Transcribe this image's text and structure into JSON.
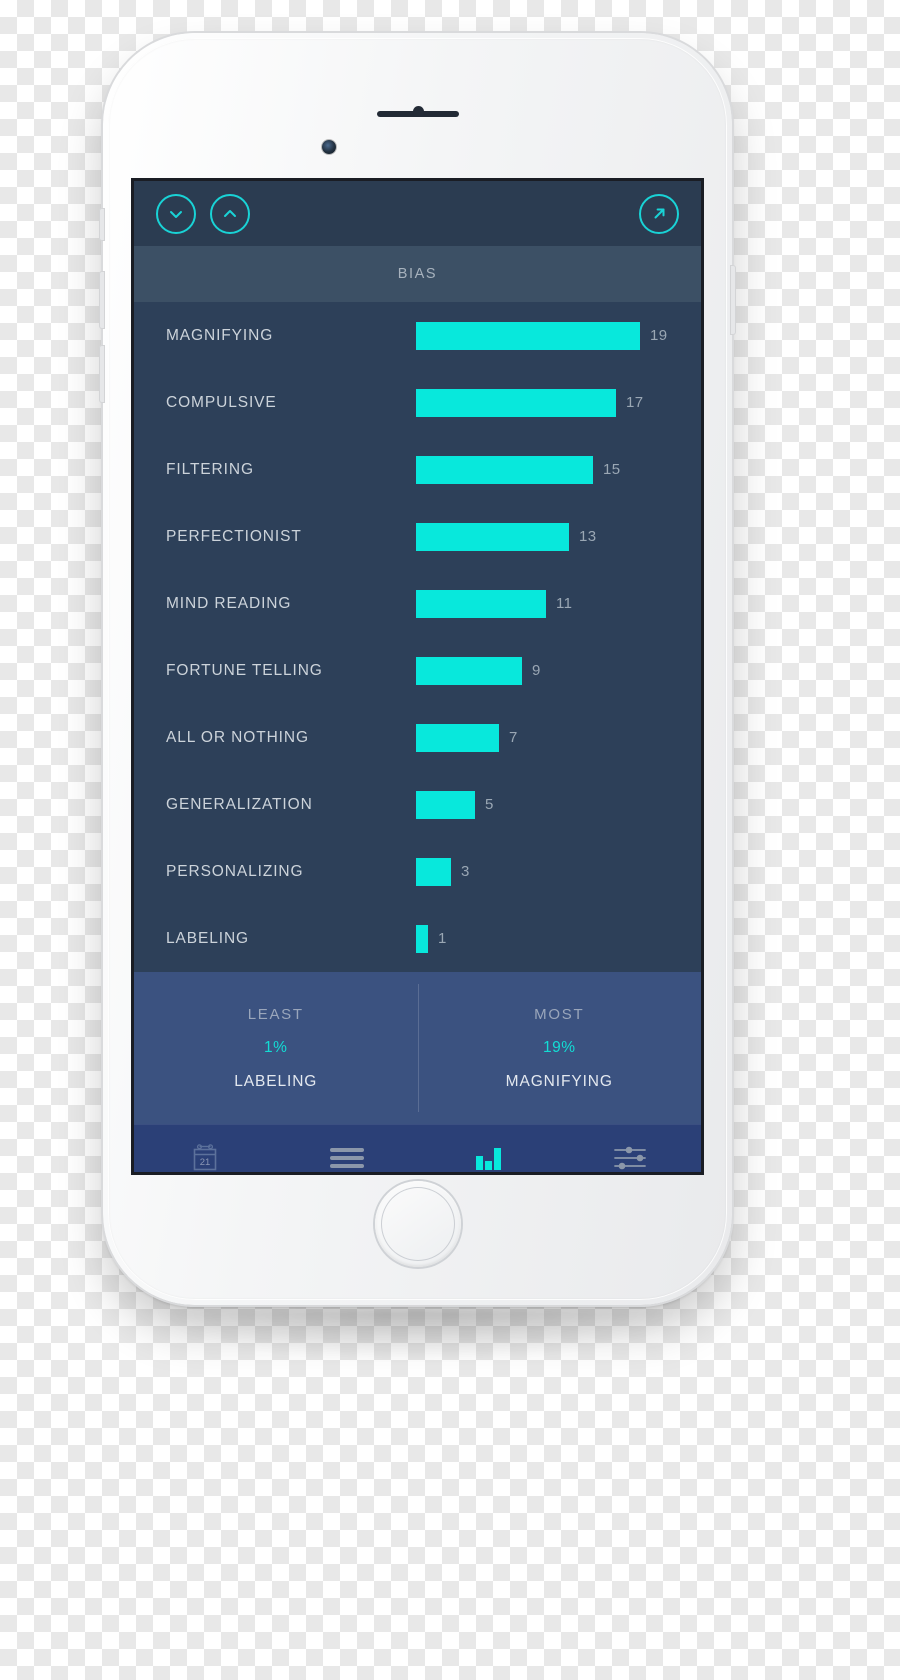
{
  "device": {
    "type": "white-smartphone"
  },
  "toolbar": {
    "collapse_label": "chevron-down",
    "expand_label": "chevron-up",
    "share_label": "arrow-up-right"
  },
  "section": {
    "title": "BIAS"
  },
  "chart_data": {
    "type": "bar",
    "title": "BIAS",
    "orientation": "horizontal",
    "categories": [
      "MAGNIFYING",
      "COMPULSIVE",
      "FILTERING",
      "PERFECTIONIST",
      "MIND READING",
      "FORTUNE TELLING",
      "ALL OR NOTHING",
      "GENERALIZATION",
      "PERSONALIZING",
      "LABELING"
    ],
    "values": [
      19,
      17,
      15,
      13,
      11,
      9,
      7,
      5,
      3,
      1
    ],
    "xlabel": "",
    "ylabel": "",
    "xlim": [
      0,
      19
    ],
    "grid": false,
    "legend": false,
    "bar_color": "#08e8dc",
    "value_label_color": "#9aa7b4",
    "background": "#2d4059"
  },
  "summary": {
    "least": {
      "title": "LEAST",
      "percent": "1%",
      "name": "LABELING"
    },
    "most": {
      "title": "MOST",
      "percent": "19%",
      "name": "MAGNIFYING"
    }
  },
  "tabs": [
    {
      "name": "calendar",
      "label": "21",
      "active": false
    },
    {
      "name": "list",
      "label": "",
      "active": false
    },
    {
      "name": "chart",
      "label": "",
      "active": true
    },
    {
      "name": "settings",
      "label": "",
      "active": false
    }
  ],
  "colors": {
    "accent": "#08e8dc",
    "screen_bg": "#2d4059",
    "toolbar_bg": "#2b3c51",
    "section_bg": "#3c5065",
    "summary_bg": "#3b5280",
    "tabbar_bg": "#2b4077",
    "label_text": "#ccd3da"
  }
}
